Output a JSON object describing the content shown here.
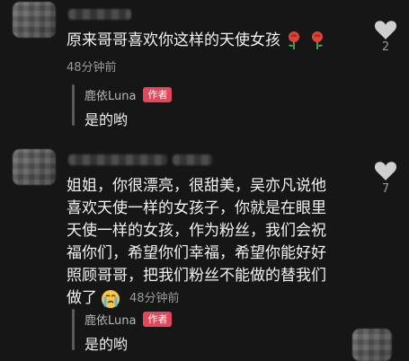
{
  "comments": [
    {
      "text": "原来哥哥喜欢你这样的天使女孩",
      "time": "48分钟前",
      "likes": "2",
      "emoji": [
        "rose-icon",
        "rose-icon"
      ],
      "reply": {
        "author": "鹿依Luna",
        "badge": "作者",
        "text": "是的哟"
      }
    },
    {
      "lines": [
        "姐姐，你很漂亮，很甜美，吴亦凡说他",
        "喜欢天使一样的女孩子，你就是在眼里",
        "天使一样的女孩，作为粉丝，我们会祝",
        "福你们，希望你们幸福，希望你能好好",
        "照顾哥哥，把我们粉丝不能做的替我们"
      ],
      "last_line": "做了",
      "emoji": "crying-face-icon",
      "time": "48分钟前",
      "likes": "7",
      "reply": {
        "author": "鹿依Luna",
        "badge": "作者",
        "text": "是的哟"
      }
    }
  ],
  "colors": {
    "background": "#161616",
    "badge": "#e5475a",
    "muted": "#9a9a9a"
  }
}
